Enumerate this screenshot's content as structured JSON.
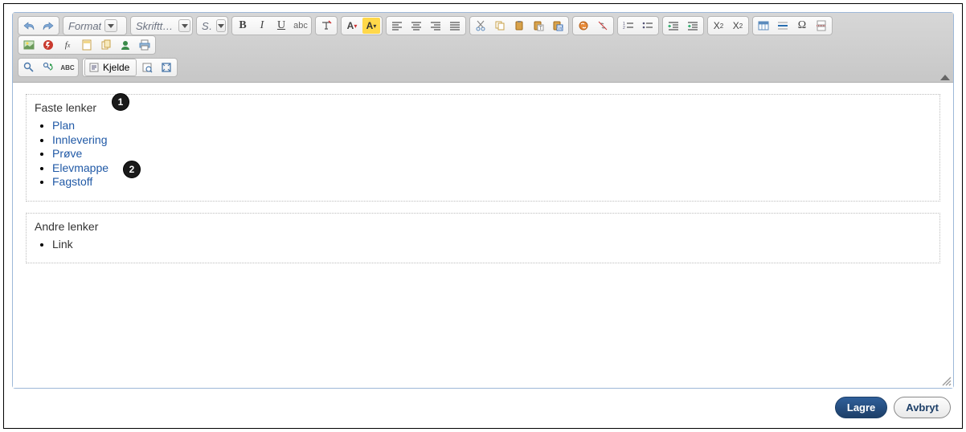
{
  "toolbar": {
    "format_label": "Format",
    "font_label": "Skrifttype",
    "size_label": "S...",
    "source_label": "Kjelde"
  },
  "content": {
    "box1": {
      "title": "Faste lenker",
      "items": [
        "Plan",
        "Innlevering",
        "Prøve",
        "Elevmappe",
        "Fagstoff"
      ]
    },
    "box2": {
      "title": "Andre lenker",
      "items": [
        "Link"
      ]
    }
  },
  "annotations": [
    "1",
    "2"
  ],
  "footer": {
    "save": "Lagre",
    "cancel": "Avbryt"
  }
}
